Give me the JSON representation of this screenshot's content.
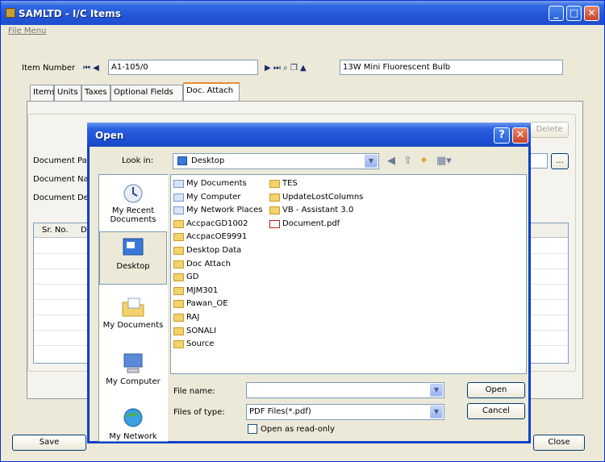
{
  "window": {
    "title": "SAMLTD - I/C Items",
    "menu_file": "File Menu"
  },
  "item": {
    "number_label": "Item Number",
    "number_value": "A1-105/0",
    "description": "13W Mini Fluorescent Bulb",
    "nav_left": "⏮ ◀",
    "nav_right": "▶ ⏭ ⌕ ❐ ▲"
  },
  "tabs": [
    {
      "label": "Items"
    },
    {
      "label": "Units"
    },
    {
      "label": "Taxes"
    },
    {
      "label": "Optional Fields"
    },
    {
      "label": "Doc. Attach"
    }
  ],
  "doc_attach": {
    "path_label": "Document Path",
    "name_label": "Document Nam",
    "desc_label": "Document Des",
    "delete_label": "Delete",
    "browse_label": "...",
    "grid_col1": "Sr. No.",
    "grid_col2": "Do"
  },
  "footer": {
    "save_label": "Save",
    "close_label": "Close"
  },
  "dialog": {
    "title": "Open",
    "help": "?",
    "close": "✕",
    "look_in_label": "Look in:",
    "look_in_value": "Desktop",
    "places": [
      {
        "label": "My Recent Documents"
      },
      {
        "label": "Desktop"
      },
      {
        "label": "My Documents"
      },
      {
        "label": "My Computer"
      },
      {
        "label": "My Network"
      }
    ],
    "files_col1": [
      {
        "name": "My Documents",
        "kind": "system"
      },
      {
        "name": "My Computer",
        "kind": "system"
      },
      {
        "name": "My Network Places",
        "kind": "system"
      },
      {
        "name": "AccpacGD1002",
        "kind": "folder"
      },
      {
        "name": "AccpacOE9991",
        "kind": "folder"
      },
      {
        "name": "Desktop Data",
        "kind": "folder"
      },
      {
        "name": "Doc Attach",
        "kind": "folder"
      },
      {
        "name": "GD",
        "kind": "folder"
      },
      {
        "name": "MJM301",
        "kind": "folder"
      },
      {
        "name": "Pawan_OE",
        "kind": "folder"
      },
      {
        "name": "RAJ",
        "kind": "folder"
      },
      {
        "name": "SONALI",
        "kind": "folder"
      },
      {
        "name": "Source",
        "kind": "folder"
      }
    ],
    "files_col2": [
      {
        "name": "TES",
        "kind": "folder"
      },
      {
        "name": "UpdateLostColumns",
        "kind": "folder"
      },
      {
        "name": "VB - Assistant 3.0",
        "kind": "folder"
      },
      {
        "name": "Document.pdf",
        "kind": "pdf"
      }
    ],
    "file_name_label": "File name:",
    "file_name_value": "",
    "file_type_label": "Files of type:",
    "file_type_value": "PDF Files(*.pdf)",
    "read_only_label": "Open as read-only",
    "open_label": "Open",
    "cancel_label": "Cancel"
  },
  "colors": {
    "xp_blue": "#0a40c8",
    "face": "#ece9d8",
    "field_border": "#7f9db9"
  }
}
